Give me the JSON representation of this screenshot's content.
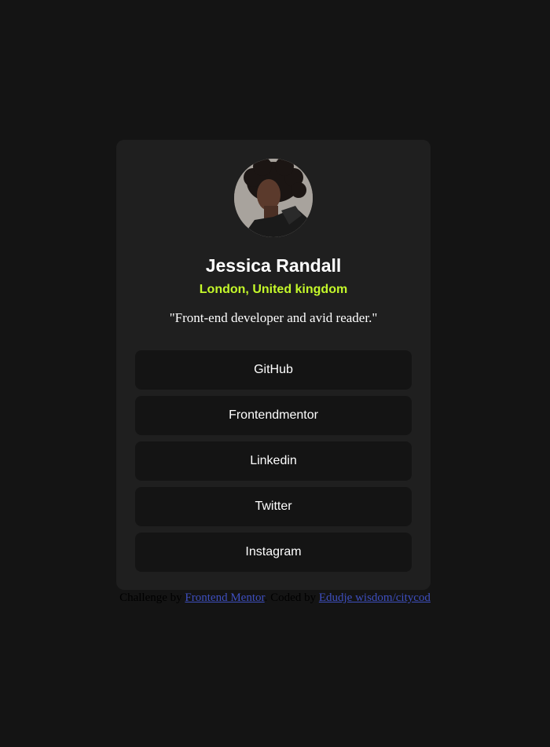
{
  "profile": {
    "name": "Jessica Randall",
    "location": "London, United kingdom",
    "bio": "\"Front-end developer and avid reader.\"",
    "avatar_icon": "profile-photo"
  },
  "links": [
    {
      "label": "GitHub"
    },
    {
      "label": "Frontendmentor"
    },
    {
      "label": "Linkedin"
    },
    {
      "label": "Twitter"
    },
    {
      "label": "Instagram"
    }
  ],
  "attribution": {
    "prefix": "Challenge by ",
    "challenge_link": "Frontend Mentor",
    "middle": ". Coded by ",
    "author_link": "Edudje wisdom/citycod"
  },
  "colors": {
    "background": "#141414",
    "card": "#1f1f1f",
    "accent": "#c4f82a",
    "link": "#3e4fbf"
  }
}
